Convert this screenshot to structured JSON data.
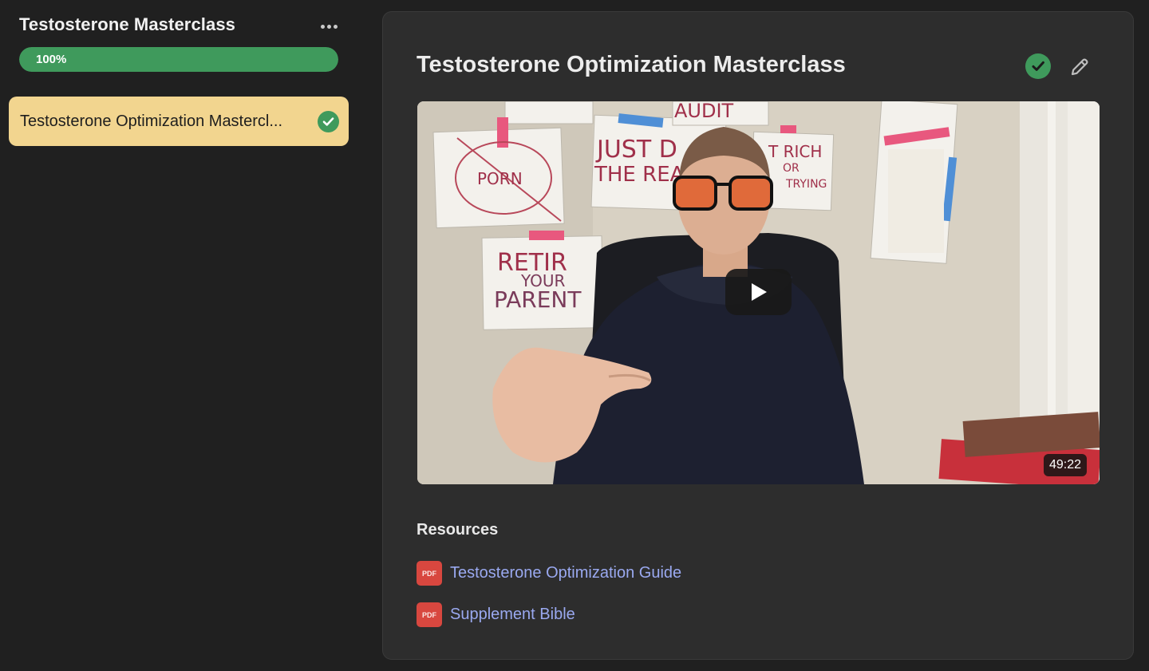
{
  "sidebar": {
    "course_title": "Testosterone Masterclass",
    "more_icon": "more-horizontal-icon",
    "progress": {
      "value": 1.0,
      "label": "100%",
      "color": "#3f9a5c"
    },
    "lessons": [
      {
        "label": "Testosterone Optimization Mastercl...",
        "completed": true,
        "highlight_color": "#f2d58f"
      }
    ]
  },
  "main": {
    "lesson_title": "Testosterone Optimization Masterclass",
    "complete_icon": "check-circle-icon",
    "edit_icon": "pencil-icon",
    "video": {
      "duration": "49:22",
      "play_icon": "play-icon"
    },
    "resources": {
      "heading": "Resources",
      "items": [
        {
          "icon_text": "PDF",
          "label": "Testosterone Optimization Guide"
        },
        {
          "icon_text": "PDF",
          "label": "Supplement Bible"
        }
      ]
    }
  },
  "colors": {
    "background": "#202020",
    "panel": "#2d2d2d",
    "accent_green": "#3f9a5c",
    "link": "#9aa9f0",
    "pdf_red": "#d8473f"
  }
}
